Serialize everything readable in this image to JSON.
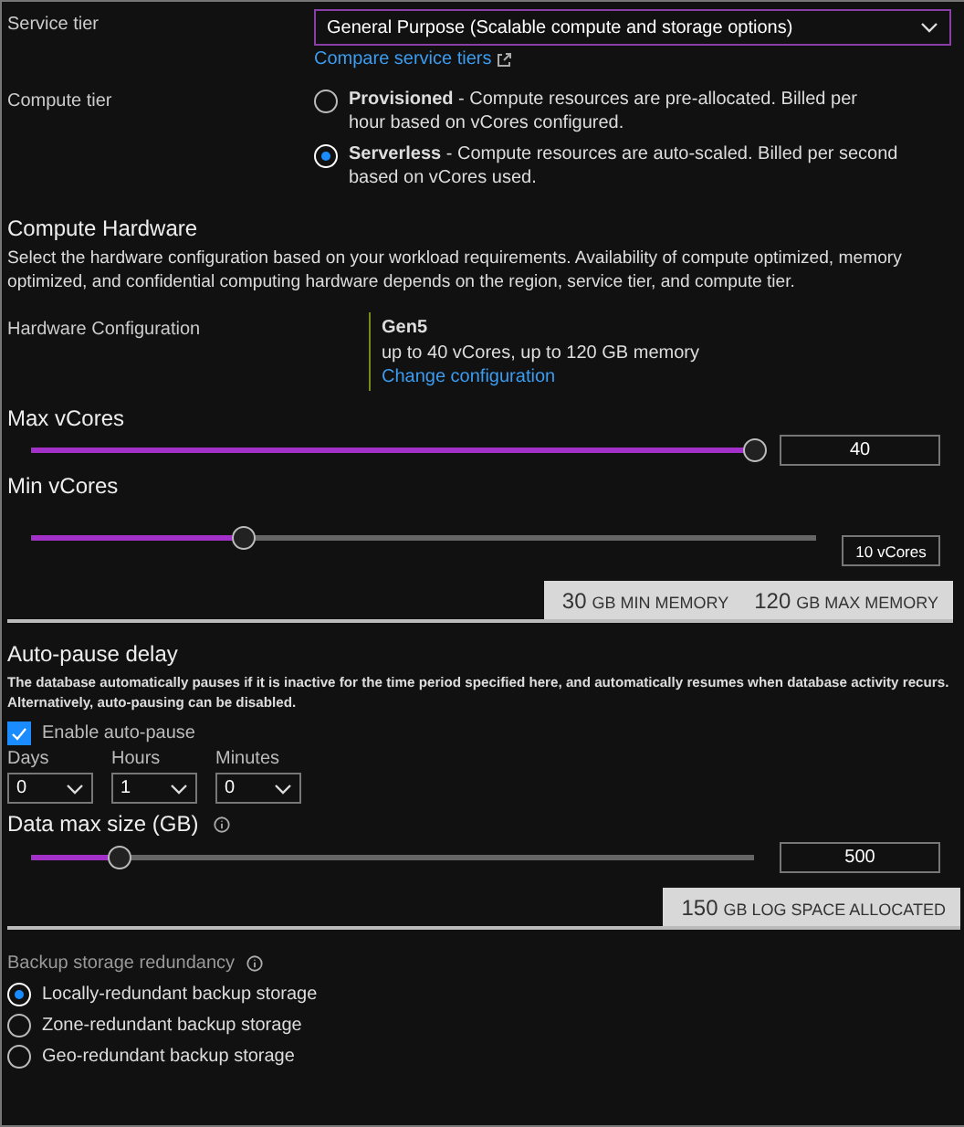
{
  "service_tier": {
    "label": "Service tier",
    "value": "General Purpose (Scalable compute and storage options)",
    "link": "Compare service tiers"
  },
  "compute_tier": {
    "label": "Compute tier",
    "options": [
      {
        "text": "**Provisioned** - Compute resources are pre-allocated. Billed per hour based on vCores configured.",
        "selected": false
      },
      {
        "text": "**Serverless** - Compute resources are auto-scaled. Billed per second based on vCores used.",
        "selected": true
      }
    ]
  },
  "compute_hardware": {
    "title": "Compute Hardware",
    "description": "Select the hardware configuration based on your workload requirements. Availability of compute optimized, memory optimized, and confidential computing hardware depends on the region, service tier, and compute tier.",
    "config_label": "Hardware Configuration",
    "config_name": "Gen5",
    "config_detail": "up to 40 vCores, up to 120 GB memory",
    "config_link": "Change configuration"
  },
  "max_vcores": {
    "label": "Max vCores",
    "level": 1,
    "value": "40"
  },
  "min_vcores": {
    "label": "Min vCores",
    "level": 0.27,
    "value": "10 vCores"
  },
  "memory_summary": [
    {
      "amount": "30",
      "unit": "GB MIN MEMORY"
    },
    {
      "amount": "120",
      "unit": "GB MAX MEMORY"
    }
  ],
  "auto_pause": {
    "title": "Auto-pause delay",
    "description": "The database automatically pauses if it is inactive for the time period specified here, and automatically resumes when database activity recurs. Alternatively, auto-pausing can be disabled.",
    "enable_label": "Enable auto-pause",
    "enabled": true,
    "fields": [
      {
        "label": "Days",
        "value": "0"
      },
      {
        "label": "Hours",
        "value": "1"
      },
      {
        "label": "Minutes",
        "value": "0"
      }
    ]
  },
  "data_max_size": {
    "label": "Data max size (GB)",
    "level": 0.12,
    "value": "500"
  },
  "log_summary": {
    "amount": "150",
    "unit": "GB LOG SPACE ALLOCATED"
  },
  "backup": {
    "label": "Backup storage redundancy",
    "options": [
      {
        "label": "Locally-redundant backup storage",
        "selected": true
      },
      {
        "label": "Zone-redundant backup storage",
        "selected": false
      },
      {
        "label": "Geo-redundant backup storage",
        "selected": false
      }
    ]
  }
}
